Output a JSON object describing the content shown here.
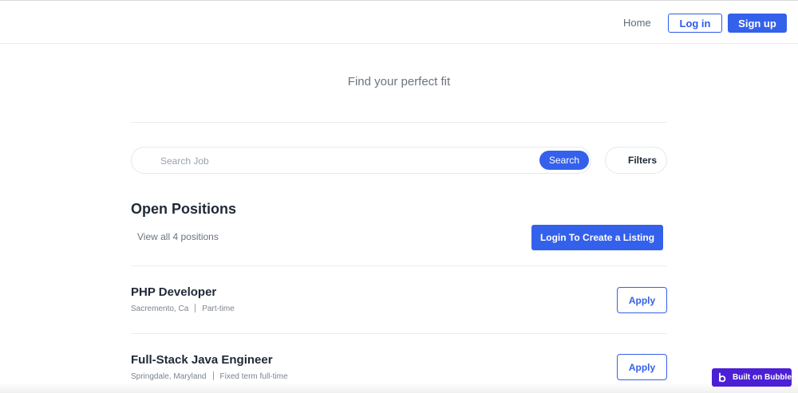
{
  "header": {
    "home_label": "Home",
    "login_label": "Log in",
    "signup_label": "Sign up"
  },
  "hero": {
    "tagline": "Find your perfect fit"
  },
  "search": {
    "placeholder": "Search Job",
    "value": "",
    "button_label": "Search",
    "filters_label": "Filters"
  },
  "positions": {
    "title": "Open Positions",
    "view_all": "View all 4 positions",
    "create_label": "Login To Create a Listing",
    "jobs": [
      {
        "title": "PHP Developer",
        "location": "Sacremento, Ca",
        "type": "Part-time",
        "apply_label": "Apply"
      },
      {
        "title": "Full-Stack Java Engineer",
        "location": "Springdale, Maryland",
        "type": "Fixed term full-time",
        "apply_label": "Apply"
      }
    ]
  },
  "badge": {
    "label": "Built on Bubble",
    "icon": "bubble-logo-icon"
  },
  "colors": {
    "primary": "#3461eb",
    "badge": "#4c1fd4",
    "text_dark": "#1f2937",
    "text_muted": "#6b7280"
  }
}
